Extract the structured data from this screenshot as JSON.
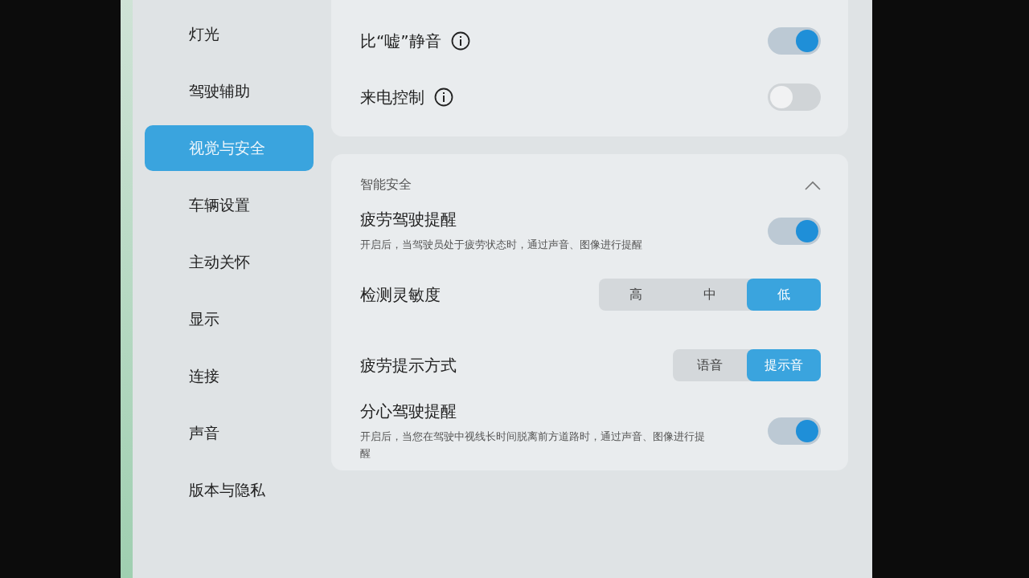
{
  "sidebar": {
    "items": [
      {
        "label": "灯光",
        "selected": false
      },
      {
        "label": "驾驶辅助",
        "selected": false
      },
      {
        "label": "视觉与安全",
        "selected": true
      },
      {
        "label": "车辆设置",
        "selected": false
      },
      {
        "label": "主动关怀",
        "selected": false
      },
      {
        "label": "显示",
        "selected": false
      },
      {
        "label": "连接",
        "selected": false
      },
      {
        "label": "声音",
        "selected": false
      },
      {
        "label": "版本与隐私",
        "selected": false
      }
    ]
  },
  "cards": [
    {
      "rows": [
        {
          "kind": "toggle",
          "label": "比“嘘”静音",
          "info": true,
          "on": true
        },
        {
          "kind": "toggle",
          "label": "来电控制",
          "info": true,
          "on": false
        }
      ]
    },
    {
      "title": "智能安全",
      "expanded": true,
      "rows": [
        {
          "kind": "toggle",
          "label": "疲劳驾驶提醒",
          "info": false,
          "on": true,
          "description": "开启后，当驾驶员处于疲劳状态时，通过声音、图像进行提醒"
        },
        {
          "kind": "segmented",
          "label": "检测灵敏度",
          "options": [
            {
              "label": "高",
              "selected": false
            },
            {
              "label": "中",
              "selected": false
            },
            {
              "label": "低",
              "selected": true
            }
          ]
        },
        {
          "kind": "segmented",
          "label": "疲劳提示方式",
          "options": [
            {
              "label": "语音",
              "selected": false
            },
            {
              "label": "提示音",
              "selected": true
            }
          ]
        },
        {
          "kind": "toggle",
          "label": "分心驾驶提醒",
          "info": false,
          "on": true,
          "description": "开启后，当您在驾驶中视线长时间脱离前方道路时，通过声音、图像进行提醒"
        }
      ]
    }
  ]
}
